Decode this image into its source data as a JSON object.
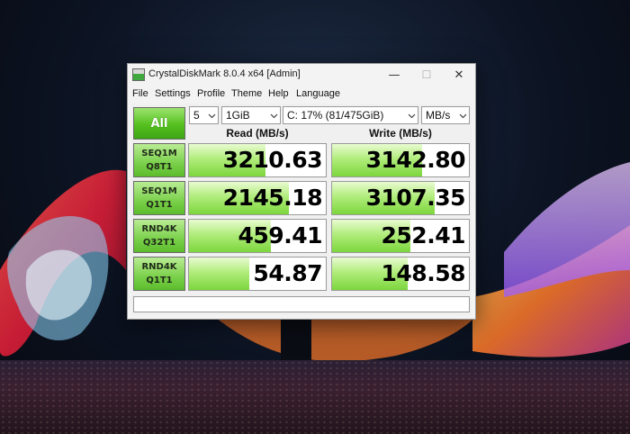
{
  "window": {
    "title": "CrystalDiskMark 8.0.4 x64 [Admin]",
    "controls": {
      "minimize": "—",
      "maximize": "☐",
      "close": "✕"
    }
  },
  "menu": [
    "File",
    "Settings",
    "Profile",
    "Theme",
    "Help",
    "Language"
  ],
  "toolbar": {
    "all_label": "All",
    "count": "5",
    "size": "1GiB",
    "drive": "C: 17% (81/475GiB)",
    "unit": "MB/s"
  },
  "headers": {
    "read": "Read (MB/s)",
    "write": "Write (MB/s)"
  },
  "rows": [
    {
      "line1": "SEQ1M",
      "line2": "Q8T1",
      "read": "3210.63",
      "write": "3142.80",
      "read_level": 0.56,
      "write_level": 0.66
    },
    {
      "line1": "SEQ1M",
      "line2": "Q1T1",
      "read": "2145.18",
      "write": "3107.35",
      "read_level": 0.73,
      "write_level": 0.75
    },
    {
      "line1": "RND4K",
      "line2": "Q32T1",
      "read": "459.41",
      "write": "252.41",
      "read_level": 0.6,
      "write_level": 0.57
    },
    {
      "line1": "RND4K",
      "line2": "Q1T1",
      "read": "54.87",
      "write": "148.58",
      "read_level": 0.44,
      "write_level": 0.55
    }
  ],
  "comment": ""
}
